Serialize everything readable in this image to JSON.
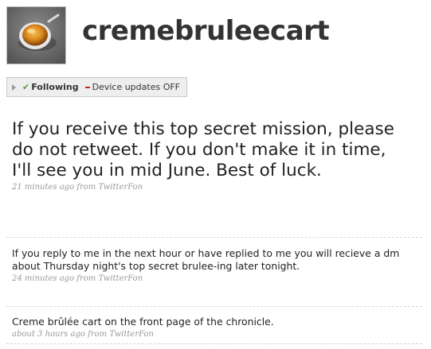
{
  "profile": {
    "username": "cremebruleecart",
    "avatar_icon": "creme-brulee-avatar-icon"
  },
  "follow_bar": {
    "following_label": "Following",
    "device_label": "Device updates OFF"
  },
  "tweets": [
    {
      "text": "If you receive this top secret mission, please do not retweet. If you don't make it in time, I'll see you in mid June. Best of luck.",
      "time": "21 minutes ago",
      "from": "from",
      "source": "TwitterFon"
    },
    {
      "text": "If you reply to me in the next hour or have replied to me you will recieve a dm about Thursday night's top secret brulee-ing later tonight.",
      "time": "24 minutes ago",
      "from": "from",
      "source": "TwitterFon"
    },
    {
      "text": "Creme brûlée cart on the front page of the chronicle.",
      "time": "about 3 hours ago",
      "from": "from",
      "source": "TwitterFon"
    }
  ]
}
